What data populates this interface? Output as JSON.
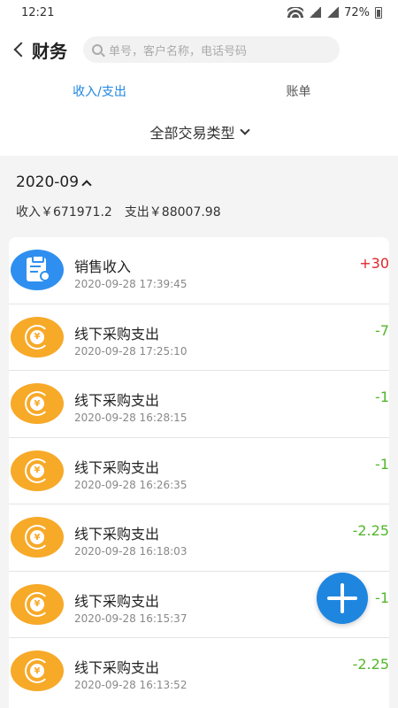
{
  "status": {
    "time": "12:21",
    "battery": "72%"
  },
  "header": {
    "title": "财务",
    "search_placeholder": "单号，客户名称，电话号码"
  },
  "tabs": [
    {
      "label": "收入/支出",
      "active": true
    },
    {
      "label": "账单",
      "active": false
    }
  ],
  "filter": {
    "label": "全部交易类型"
  },
  "summary": {
    "month": "2020-09",
    "income": "收入￥671971.2",
    "expense": "支出￥88007.98"
  },
  "colors": {
    "accent": "#1f86e0",
    "income": "#e0262b",
    "expense": "#52b72b",
    "icon_orange": "#f7a928",
    "icon_blue": "#2f8ff0"
  },
  "transactions": [
    {
      "name": "销售收入",
      "time": "2020-09-28 17:39:45",
      "amount": "+30",
      "kind": "income",
      "icon": "clipboard-check-icon"
    },
    {
      "name": "线下采购支出",
      "time": "2020-09-28 17:25:10",
      "amount": "-7",
      "kind": "expense",
      "icon": "yen-coin-icon"
    },
    {
      "name": "线下采购支出",
      "time": "2020-09-28 16:28:15",
      "amount": "-1",
      "kind": "expense",
      "icon": "yen-coin-icon"
    },
    {
      "name": "线下采购支出",
      "time": "2020-09-28 16:26:35",
      "amount": "-1",
      "kind": "expense",
      "icon": "yen-coin-icon"
    },
    {
      "name": "线下采购支出",
      "time": "2020-09-28 16:18:03",
      "amount": "-2.25",
      "kind": "expense",
      "icon": "yen-coin-icon"
    },
    {
      "name": "线下采购支出",
      "time": "2020-09-28 16:15:37",
      "amount": "-1",
      "kind": "expense",
      "icon": "yen-coin-icon"
    },
    {
      "name": "线下采购支出",
      "time": "2020-09-28 16:13:52",
      "amount": "-2.25",
      "kind": "expense",
      "icon": "yen-coin-icon"
    }
  ]
}
